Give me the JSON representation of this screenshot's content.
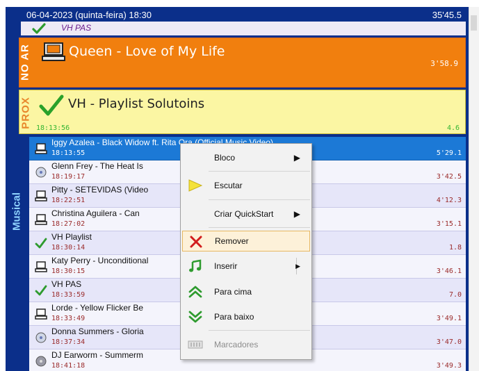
{
  "header": {
    "datetime": "06-04-2023 (quinta-feira) 18:30",
    "total": "35'45.5"
  },
  "previous": {
    "title": "VH PAS"
  },
  "on_air": {
    "label": "NO AR",
    "title": "Queen - Love of My Life",
    "duration": "3'58.9"
  },
  "next": {
    "label": "PROX",
    "title": "VH - Playlist Solutoins",
    "time": "18:13:56",
    "duration": "4.6"
  },
  "category": "Musical",
  "playlist": [
    {
      "title": "Iggy Azalea - Black Widow ft. Rita Ora (Official Music Video)",
      "time": "18:13:55",
      "duration": "5'29.1",
      "icon": "computer-icon"
    },
    {
      "title": "Glenn Frey - The Heat Is",
      "time": "18:19:17",
      "duration": "3'42.5",
      "icon": "cd-icon"
    },
    {
      "title": "Pitty - SETEVIDAS (Video",
      "time": "18:22:51",
      "duration": "4'12.3",
      "icon": "computer-icon"
    },
    {
      "title": "Christina Aguilera - Can",
      "time": "18:27:02",
      "duration": "3'15.1",
      "icon": "computer-icon"
    },
    {
      "title": "VH Playlist",
      "time": "18:30:14",
      "duration": "1.8",
      "icon": "check-icon"
    },
    {
      "title": "Katy Perry - Unconditional",
      "time": "18:30:15",
      "duration": "3'46.1",
      "icon": "computer-icon"
    },
    {
      "title": "VH PAS",
      "time": "18:33:59",
      "duration": "7.0",
      "icon": "check-icon"
    },
    {
      "title": "Lorde - Yellow Flicker Be",
      "time": "18:33:49",
      "duration": "3'49.1",
      "icon": "computer-icon"
    },
    {
      "title": "Donna Summers - Gloria",
      "time": "18:37:34",
      "duration": "3'47.0",
      "icon": "cd-icon"
    },
    {
      "title": "DJ Earworm - Summerm",
      "time": "18:41:18",
      "duration": "3'49.3",
      "icon": "disc-icon"
    }
  ],
  "context_menu": {
    "items": [
      {
        "label": "Bloco",
        "icon": "",
        "submenu": true
      },
      {
        "label": "Escutar",
        "icon": "play-icon"
      },
      {
        "label": "Criar QuickStart",
        "icon": "",
        "submenu": true
      },
      {
        "label": "Remover",
        "icon": "remove-icon",
        "highlighted": true
      },
      {
        "label": "Inserir",
        "icon": "music-note-icon",
        "submenu": true
      },
      {
        "label": "Para cima",
        "icon": "chevron-up-icon"
      },
      {
        "label": "Para baixo",
        "icon": "chevron-down-icon"
      },
      {
        "label": "Marcadores",
        "icon": "markers-icon",
        "disabled": true
      }
    ]
  },
  "colors": {
    "frame": "#0b2f8a",
    "on_air": "#f17f0e",
    "next": "#fbf6a3",
    "selected": "#1c79d6"
  }
}
